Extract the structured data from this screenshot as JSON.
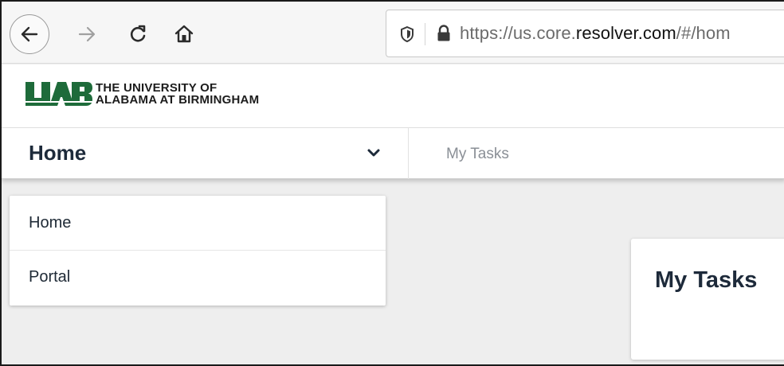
{
  "browser": {
    "url_prefix": "https://us.core.",
    "url_domain": "resolver.com",
    "url_suffix": "/#/hom",
    "icons": [
      "back-arrow-icon",
      "forward-arrow-icon",
      "reload-icon",
      "home-icon",
      "shield-icon",
      "lock-icon"
    ]
  },
  "header": {
    "logo_mark": "UAB",
    "logo_line1": "THE UNIVERSITY OF",
    "logo_line2": "ALABAMA AT BIRMINGHAM",
    "logo_color": "#1e6b3a"
  },
  "nav": {
    "title": "Home",
    "tab": "My Tasks"
  },
  "dropdown": {
    "items": [
      {
        "label": "Home"
      },
      {
        "label": "Portal"
      }
    ]
  },
  "tasks_card": {
    "title": "My Tasks"
  }
}
